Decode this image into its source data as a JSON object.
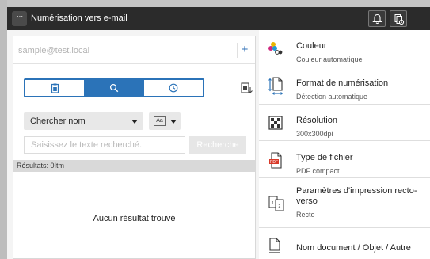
{
  "titlebar": {
    "menu_label": "···",
    "title": "Numérisation vers e-mail",
    "icons": [
      "bell-icon",
      "job-status-icon"
    ]
  },
  "address": {
    "email_placeholder": "sample@test.local",
    "add_label": "+"
  },
  "tabs": [
    {
      "icon": "address-book-icon",
      "active": false
    },
    {
      "icon": "search-icon",
      "active": true
    },
    {
      "icon": "history-clock-icon",
      "active": false
    }
  ],
  "search": {
    "search_by": "Chercher nom",
    "case_label": "Aa",
    "placeholder": "Saisissez le texte recherché.",
    "button_label": "Recherche"
  },
  "results": {
    "count_label": "Résultats: 0Itm",
    "empty_message": "Aucun résultat trouvé"
  },
  "settings": [
    {
      "icon": "color-icon",
      "label": "Couleur",
      "value": "Couleur automatique"
    },
    {
      "icon": "scan-format-icon",
      "label": "Format de numérisation",
      "value": "Détection automatique"
    },
    {
      "icon": "resolution-icon",
      "label": "Résolution",
      "value": "300x300dpi"
    },
    {
      "icon": "file-type-icon",
      "label": "Type de fichier",
      "value": "PDF compact"
    },
    {
      "icon": "duplex-icon",
      "label": "Paramètres d'impression recto-verso",
      "value": "Recto"
    },
    {
      "icon": "document-name-icon",
      "label": "Nom document / Objet / Autre",
      "value": ""
    }
  ],
  "colors": {
    "accent": "#2b73b8",
    "titlebar": "#2b2b2b"
  }
}
